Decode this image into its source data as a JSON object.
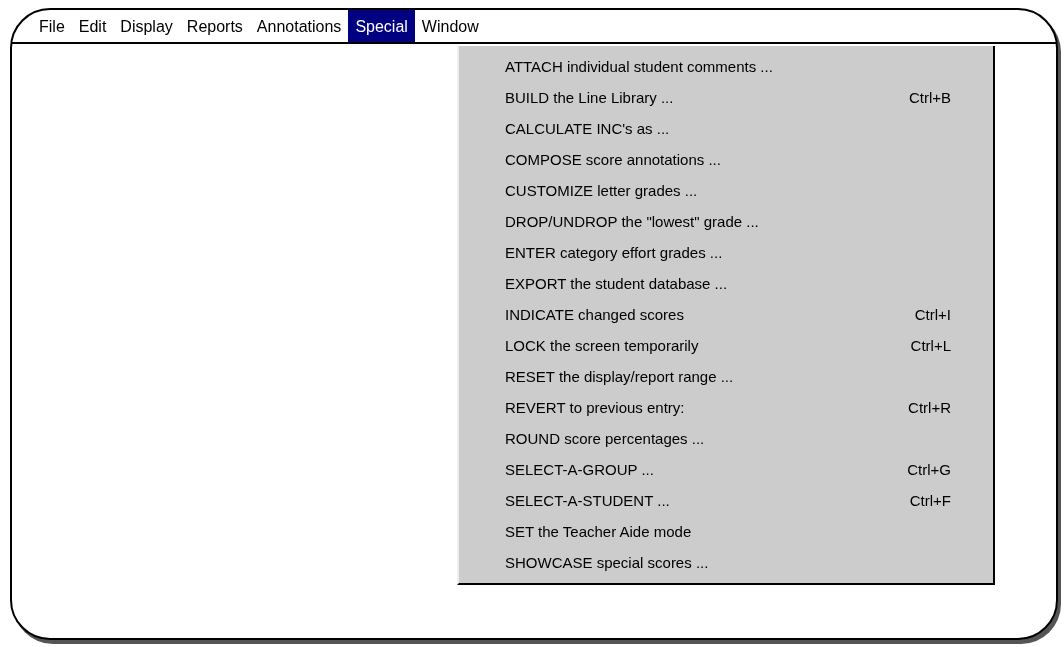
{
  "menu_bar": [
    {
      "label": "File",
      "selected": false
    },
    {
      "label": "Edit",
      "selected": false
    },
    {
      "label": "Display",
      "selected": false
    },
    {
      "label": "Reports",
      "selected": false
    },
    {
      "label": "Annotations",
      "selected": false
    },
    {
      "label": "Special",
      "selected": true
    },
    {
      "label": "Window",
      "selected": false
    }
  ],
  "dropdown_menu": {
    "items": [
      {
        "label": "ATTACH individual student comments ..."
      },
      {
        "label": "BUILD the Line Library ...",
        "shortcut": "Ctrl+B"
      },
      {
        "label": "CALCULATE INC's as ..."
      },
      {
        "label": "COMPOSE score annotations ..."
      },
      {
        "label": "CUSTOMIZE letter grades ..."
      },
      {
        "label": "DROP/UNDROP the \"lowest\" grade ..."
      },
      {
        "label": "ENTER category effort grades ..."
      },
      {
        "label": "EXPORT the student database ..."
      },
      {
        "label": "INDICATE changed scores",
        "shortcut": "Ctrl+I"
      },
      {
        "label": "LOCK the screen temporarily",
        "shortcut": "Ctrl+L"
      },
      {
        "label": "RESET the display/report range ..."
      },
      {
        "label": "REVERT to previous entry:",
        "shortcut": "Ctrl+R"
      },
      {
        "label": "ROUND score percentages ..."
      },
      {
        "label": "SELECT-A-GROUP ...",
        "shortcut": "Ctrl+G"
      },
      {
        "label": "SELECT-A-STUDENT ...",
        "shortcut": "Ctrl+F"
      },
      {
        "label": "SET the Teacher Aide mode"
      },
      {
        "label": "SHOWCASE special scores ..."
      }
    ]
  }
}
